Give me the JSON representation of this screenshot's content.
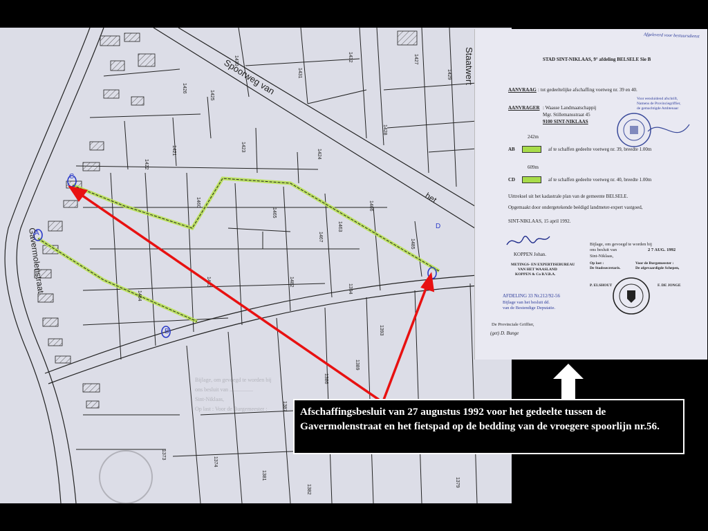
{
  "map": {
    "railway_label": "Spoorweg van",
    "railway_label_2": "het",
    "street_label": "Gavermolenstraat",
    "street_label_2": "Staatwert",
    "parcel_numbers": [
      "1430",
      "1431",
      "1432",
      "1427",
      "1429",
      "1426",
      "1425",
      "1421",
      "1422",
      "1423",
      "1424",
      "1428",
      "1460",
      "1465",
      "1466",
      "1463",
      "1467",
      "1485",
      "1484",
      "1483",
      "1482",
      "1394",
      "1393",
      "1389",
      "1386",
      "1387",
      "1373",
      "1374",
      "1381",
      "1382",
      "1380",
      "1379"
    ],
    "point_labels": {
      "c": "C",
      "d": "D",
      "a": "A",
      "b": "B"
    },
    "colors": {
      "paper": "#dadbe6",
      "lines": "#222",
      "highlight": "#b7e34a",
      "arrow": "#e81111"
    }
  },
  "document": {
    "top_stamp": "Afgeleverd voor bestuursdienst",
    "heading": "STAD SINT-NIKLAAS, 9° afdeling BELSELE Sie B",
    "aanvraag_label": "AANVRAAG",
    "aanvraag_text": ": tot gedeeltelijke afschaffing voetweg nr. 39 en 40.",
    "aanvrager_label": "AANVRAGER",
    "aanvrager_line1": ": Waasse Landmaatschappij",
    "aanvrager_line2": "Mgr. Stillemansstraat 45",
    "aanvrager_line3": "9100 SINT-NIKLAAS",
    "stamp_text_1": "Voor eensluidend afschrift,",
    "stamp_text_2": "Namens de Provinciegriffier,",
    "stamp_text_3": "de gemachtigde Ambtenaar",
    "ab_length": "242m",
    "ab_label": "AB",
    "ab_text": "af te schaffen gedeelte voetweg nr. 39, breedte 1.00m",
    "cd_length": "609m",
    "cd_label": "CD",
    "cd_text": "af te schaffen gedeelte voetweg nr. 40, breedte 1.00m",
    "extract_text": "Uittreksel uit het kadastrale plan van de gemeente BELSELE.",
    "made_text": "Opgemaakt door ondergetekende beëdigd landmeter-expert vastgoed,",
    "place_date": "SINT-NIKLAAS, 15 april 1992.",
    "signer": "KOPPEN Johan.",
    "firm_line1": "METINGS- EN EXPERTISEBUREAU",
    "firm_line2": "VAN HET WAASLAND",
    "firm_line3": "KOPPEN & Co B.V.B.A.",
    "council_line1": "Bijlage, om gevoegd te worden bij",
    "council_line2": "ons besluit van",
    "council_date": "2 7 AUG. 1992",
    "council_line3": "Sint-Niklaas,",
    "council_order": "Op last :",
    "council_secretary": "De Stadssecretaris.",
    "council_mayor": "Voor de Burgemeester :",
    "council_alderman": "De afgevaardigde Schepen,",
    "name_left": "P. ELSHOUT",
    "name_right": "F. DE JONGE",
    "afdeling": "AFDELING 33 Nr.212/92-56",
    "afdeling_note": "Bijlage van het besluit dd.",
    "afdeling_note_2": "van de Bestendige Deputatie.",
    "griffier": "De Provinciale Griffier,",
    "griffier_sig": "(get) D. Bunge",
    "seal_text": "STADSBESTUUR SINT-NIKLAAS"
  },
  "caption": {
    "text": "Afschaffingsbesluit van 27 augustus 1992 voor het gedeelte tussen de Gavermolenstraat en het fietspad op de bedding van de vroegere spoorlijn nr.56."
  }
}
